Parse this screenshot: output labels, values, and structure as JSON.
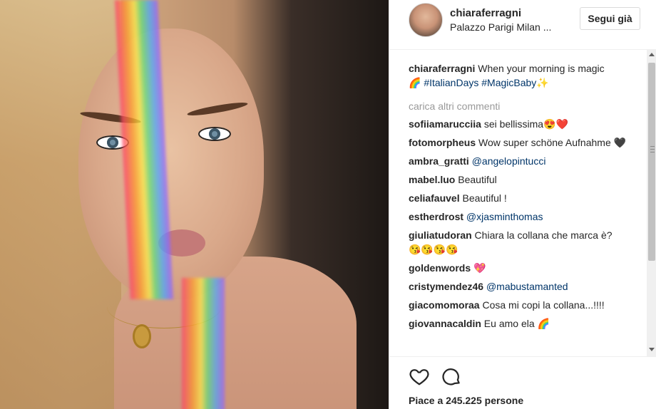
{
  "post": {
    "author": "chiaraferragni",
    "location": "Palazzo Parigi Milan ...",
    "follow_label": "Segui già",
    "caption": {
      "user": "chiaraferragni",
      "text": " When your morning is magic",
      "emoji1": "🌈",
      "tags": " #ItalianDays #MagicBaby",
      "emoji2": "✨"
    },
    "load_more": "carica altri commenti",
    "comments": [
      {
        "user": "sofiiamarucciia",
        "text": " sei bellissima",
        "emoji": "😍❤️"
      },
      {
        "user": "fotomorpheus",
        "text": " Wow super schöne Aufnahme ",
        "emoji": "🖤"
      },
      {
        "user": "ambra_gratti",
        "text": "",
        "mention": " @angelopintucci"
      },
      {
        "user": "mabel.luo",
        "text": " Beautiful"
      },
      {
        "user": "celiafauvel",
        "text": " Beautiful !"
      },
      {
        "user": "estherdrost",
        "text": "",
        "mention": " @xjasminthomas"
      },
      {
        "user": "giuliatudoran",
        "text": " Chiara la collana che marca è?",
        "emoji": "😘😘😘😘"
      },
      {
        "user": "goldenwords",
        "text": " ",
        "emoji": "💖"
      },
      {
        "user": "cristymendez46",
        "text": "",
        "mention": " @mabustamanted"
      },
      {
        "user": "giacomomoraa",
        "text": " Cosa mi copi la collana...!!!!"
      },
      {
        "user": "giovannacaldin",
        "text": " Eu amo ela ",
        "emoji": "🌈"
      }
    ],
    "likes": "Piace a 245.225 persone"
  },
  "icons": {
    "like": "heart-icon",
    "comment": "comment-icon"
  },
  "colors": {
    "text": "#262626",
    "muted": "#999999",
    "link": "#003569",
    "border": "#efefef"
  }
}
